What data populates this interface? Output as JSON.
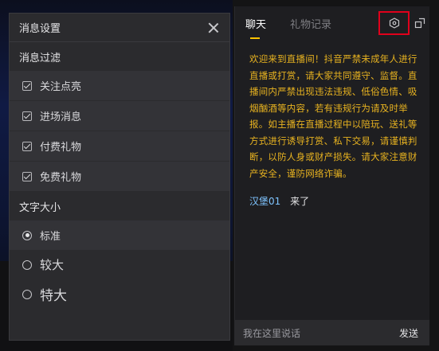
{
  "settings": {
    "title": "消息设置",
    "filter_label": "消息过滤",
    "filters": [
      {
        "label": "关注点亮",
        "checked": true
      },
      {
        "label": "进场消息",
        "checked": true
      },
      {
        "label": "付费礼物",
        "checked": true
      },
      {
        "label": "免费礼物",
        "checked": true
      }
    ],
    "font_size_label": "文字大小",
    "font_sizes": [
      {
        "label": "标准",
        "selected": true
      },
      {
        "label": "较大",
        "selected": false
      },
      {
        "label": "特大",
        "selected": false
      }
    ]
  },
  "chat": {
    "tabs": [
      {
        "label": "聊天",
        "active": true
      },
      {
        "label": "礼物记录",
        "active": false
      }
    ],
    "welcome": "欢迎来到直播间！抖音严禁未成年人进行直播或打赏，请大家共同遵守、监督。直播间内严禁出现违法违规、低俗色情、吸烟酗酒等内容，若有违规行为请及时举报。如主播在直播过程中以陪玩、送礼等方式进行诱导打赏、私下交易，请谨慎判断，以防人身或财产损失。请大家注意财产安全，谨防网络诈骗。",
    "message": {
      "user": "汉堡01",
      "text": "来了"
    },
    "input_placeholder": "我在这里说话",
    "send_label": "发送"
  },
  "colors": {
    "accent_yellow": "#ffc300",
    "welcome_text": "#e8b320",
    "username": "#7fc4ff",
    "highlight_box": "#e0001b"
  }
}
